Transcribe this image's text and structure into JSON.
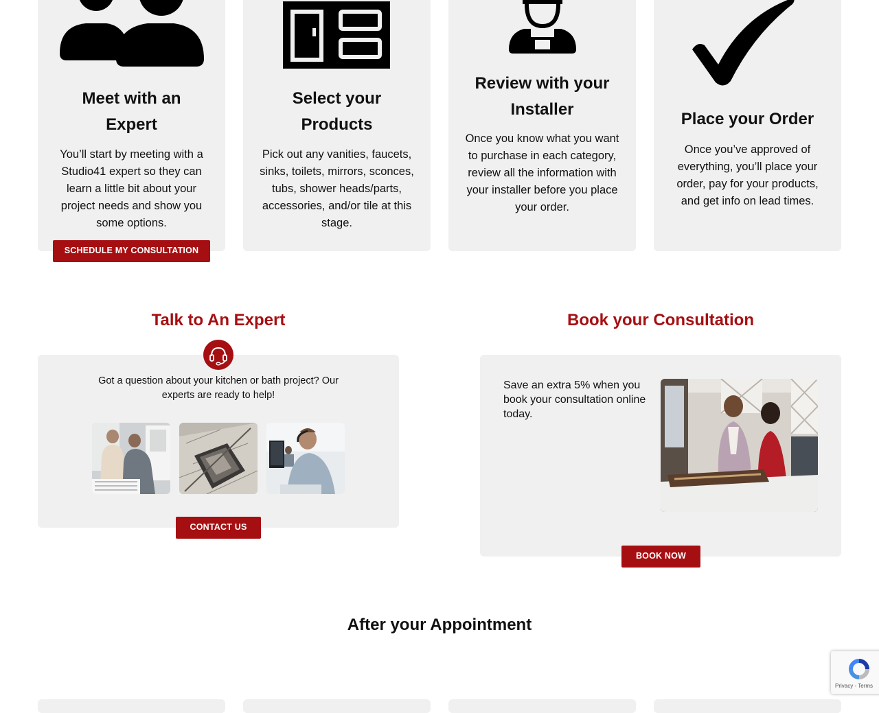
{
  "steps": [
    {
      "title_line1": "Meet with an",
      "title_line2": "Expert",
      "icon": "people-icon",
      "description": [
        "You’ll start by meeting with a",
        "Studio41 expert so they can",
        "learn a little bit about your",
        "project needs and show you",
        "some options."
      ],
      "button": "SCHEDULE MY CONSULTATION"
    },
    {
      "title_line1": "Select your",
      "title_line2": "Products",
      "icon": "cabinet-icon",
      "description": [
        "Pick out any vanities, faucets,",
        "sinks, toilets, mirrors, sconces,",
        "tubs, shower heads/parts,",
        "accessories, and/or tile at this",
        "stage."
      ]
    },
    {
      "title_line1": "Review with your",
      "title_line2": "Installer",
      "icon": "installer-icon",
      "description": [
        "Once you know what you want",
        "to purchase in each category,",
        "review all the information with",
        "your installer before you place",
        "your order."
      ]
    },
    {
      "title_line1": "Place your Order",
      "icon": "checkmark-icon",
      "description": [
        "Once you’ve approved of",
        "everything, you’ll place your",
        "order, pay for your products,",
        "and get info on lead times."
      ]
    }
  ],
  "expert": {
    "heading": "Talk to An Expert",
    "text_line1": "Got a question about your kitchen or bath project? Our",
    "text_line2": "experts are ready to help!",
    "button": "CONTACT US",
    "icon": "headset-icon"
  },
  "consultation": {
    "heading": "Book your Consultation",
    "text_line1": "Save an extra 5% when you",
    "text_line2": "book your consultation online",
    "text_line3": "today.",
    "button": "BOOK NOW"
  },
  "after": {
    "heading": "After your Appointment"
  },
  "recaptcha": {
    "privacy": "Privacy",
    "sep": " - ",
    "terms": "Terms"
  },
  "colors": {
    "accent": "#a60f12",
    "card_bg": "#f0f0f0"
  }
}
